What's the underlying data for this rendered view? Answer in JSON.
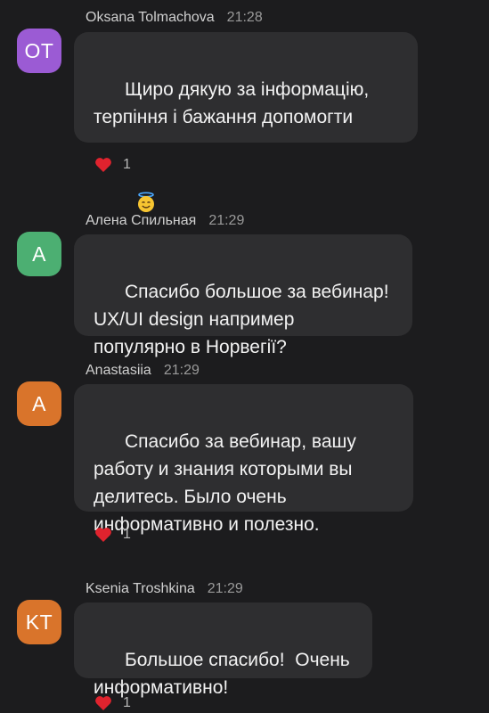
{
  "colors": {
    "background": "#1c1c1e",
    "bubble": "#2e2e30",
    "avatar_purple": "#9b5bd4",
    "avatar_green": "#4caf72",
    "avatar_orange": "#d9742b",
    "heart": "#e0232e"
  },
  "messages": [
    {
      "author": "Oksana Tolmachova",
      "time": "21:28",
      "initials": "OT",
      "avatar_color": "#9b5bd4",
      "text": "Щиро дякую за інформацію,\nтерпіння і бажання допомогти",
      "emoji": "smiling-face-with-halo",
      "reaction": {
        "icon": "red-heart-icon",
        "count": "1"
      }
    },
    {
      "author": "Алена Спильная",
      "time": "21:29",
      "initials": "A",
      "avatar_color": "#4caf72",
      "text": "Спасибо большое за вебинар!\nUX/UI design например\nпопулярно в Норвегії?"
    },
    {
      "author": "Anastasiia",
      "time": "21:29",
      "initials": "A",
      "avatar_color": "#d9742b",
      "text": "Спасибо за вебинар, вашу\nработу и знания которыми вы\nделитесь. Было очень\nинформативно и полезно.",
      "reaction": {
        "icon": "red-heart-icon",
        "count": "1"
      }
    },
    {
      "author": "Ksenia Troshkina",
      "time": "21:29",
      "initials": "KT",
      "avatar_color": "#d9742b",
      "text": "Большое спасибо!  Очень\nинформативно!",
      "reaction": {
        "icon": "red-heart-icon",
        "count": "1"
      }
    }
  ]
}
